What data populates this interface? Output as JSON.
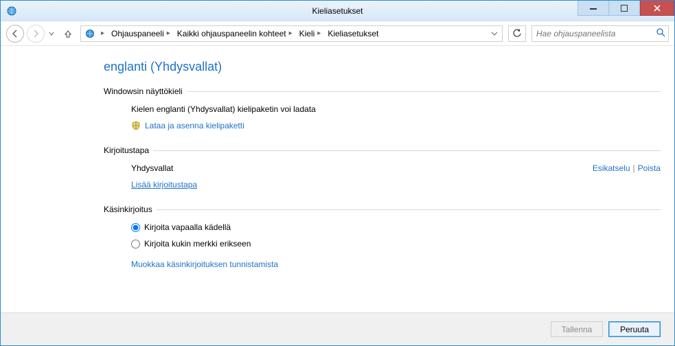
{
  "window": {
    "title": "Kieliasetukset"
  },
  "breadcrumb": {
    "items": [
      "Ohjauspaneeli",
      "Kaikki ohjauspaneelin kohteet",
      "Kieli",
      "Kieliasetukset"
    ]
  },
  "search": {
    "placeholder": "Hae ohjauspaneelista"
  },
  "page": {
    "title": "englanti (Yhdysvallat)"
  },
  "sections": {
    "display_language": {
      "header": "Windowsin näyttökieli",
      "desc": "Kielen englanti (Yhdysvallat) kielipaketin voi ladata",
      "download_link": "Lataa ja asenna kielipaketti"
    },
    "input_method": {
      "header": "Kirjoitustapa",
      "name": "Yhdysvallat",
      "preview": "Esikatselu",
      "remove": "Poista",
      "add_link": "Lisää kirjoitustapa"
    },
    "handwriting": {
      "header": "Käsinkirjoitus",
      "option_free": "Kirjoita vapaalla kädellä",
      "option_char": "Kirjoita kukin merkki erikseen",
      "edit_link": "Muokkaa käsinkirjoituksen tunnistamista"
    }
  },
  "footer": {
    "save": "Tallenna",
    "cancel": "Peruuta"
  }
}
